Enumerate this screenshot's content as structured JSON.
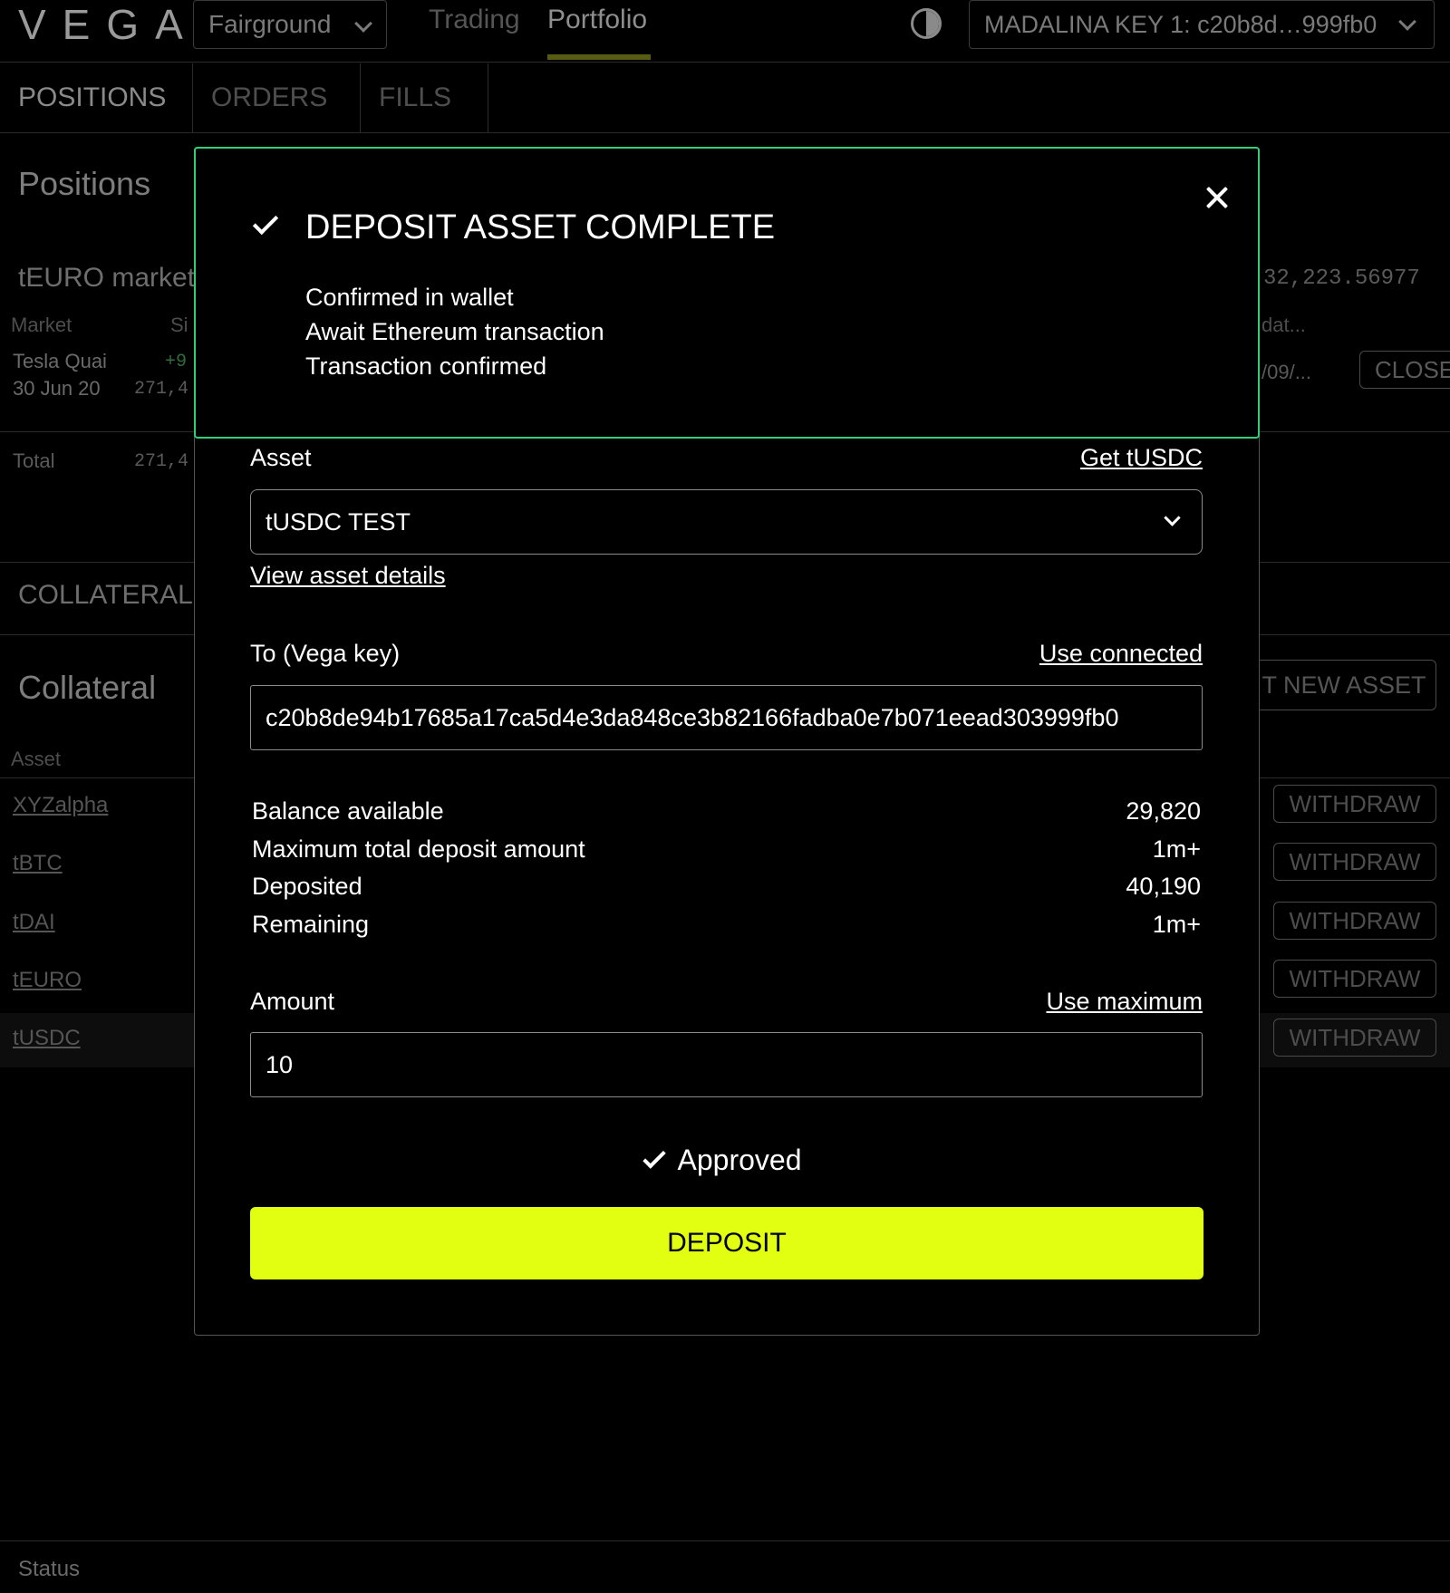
{
  "header": {
    "logo": "VEGA",
    "network": "Fairground",
    "nav": [
      "Trading",
      "Portfolio"
    ],
    "active_nav": "Portfolio",
    "key_selector": "MADALINA KEY 1: c20b8d…999fb0"
  },
  "tabs": [
    "POSITIONS",
    "ORDERS",
    "FILLS"
  ],
  "positions": {
    "title": "Positions",
    "market_group": "tEURO market",
    "market_total": "32,223.56977",
    "columns": [
      "Market",
      "Si",
      "dat..."
    ],
    "row": {
      "market": "Tesla Quai",
      "date": "30 Jun 20",
      "change": "+9",
      "size": "271,4",
      "updated": "/09/...",
      "close_label": "CLOSE"
    },
    "total_label": "Total",
    "total_value": "271,4"
  },
  "collateral": {
    "tab": "COLLATERAL",
    "title": "Collateral",
    "deposit_new_label": "IT NEW ASSET",
    "column_asset": "Asset",
    "assets": [
      "XYZalpha",
      "tBTC",
      "tDAI",
      "tEURO",
      "tUSDC"
    ],
    "withdraw_label": "WITHDRAW"
  },
  "toast": {
    "title": "DEPOSIT ASSET COMPLETE",
    "steps": [
      "Confirmed in wallet",
      "Await Ethereum transaction",
      "Transaction confirmed"
    ],
    "close_icon": "close-icon"
  },
  "deposit_form": {
    "asset_label": "Asset",
    "get_asset_link": "Get tUSDC",
    "asset_value": "tUSDC TEST",
    "view_details_link": "View asset details",
    "to_label": "To (Vega key)",
    "use_connected_link": "Use connected",
    "to_value": "c20b8de94b17685a17ca5d4e3da848ce3b82166fadba0e7b071eead303999fb0",
    "stats": [
      {
        "label": "Balance available",
        "value": "29,820"
      },
      {
        "label": "Maximum total deposit amount",
        "value": "1m+"
      },
      {
        "label": "Deposited",
        "value": "40,190"
      },
      {
        "label": "Remaining",
        "value": "1m+"
      }
    ],
    "amount_label": "Amount",
    "use_max_link": "Use maximum",
    "amount_value": "10",
    "approved_label": "Approved",
    "deposit_button": "DEPOSIT"
  },
  "footer": {
    "status": "Status"
  },
  "colors": {
    "accent": "#e2ff12",
    "toast_border": "#2fcf7a",
    "background": "#000000"
  }
}
